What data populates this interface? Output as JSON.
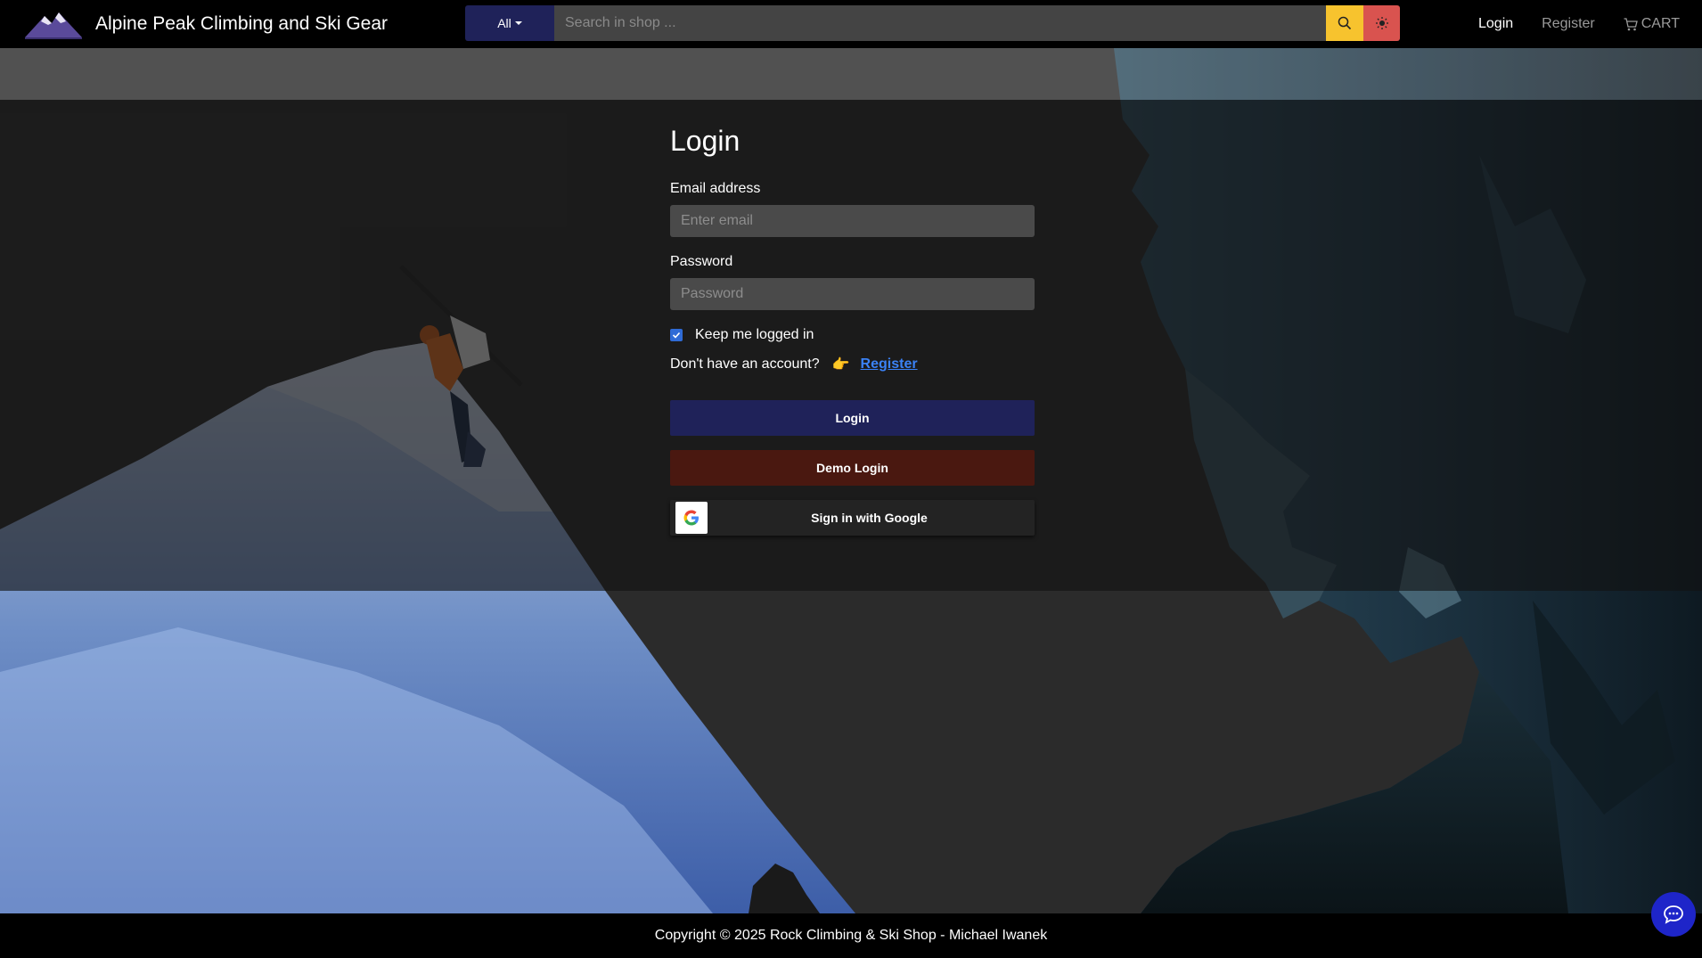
{
  "navbar": {
    "brand_title": "Alpine Peak Climbing and Ski Gear",
    "search": {
      "category": "All",
      "placeholder": "Search in shop ...",
      "value": ""
    },
    "links": {
      "login": "Login",
      "register": "Register",
      "cart": "CART"
    }
  },
  "login": {
    "title": "Login",
    "email_label": "Email address",
    "email_placeholder": "Enter email",
    "password_label": "Password",
    "password_placeholder": "Password",
    "remember_label": "Keep me logged in",
    "remember_checked": true,
    "no_account_text": "Don't have an account?",
    "hand_emoji": "👉",
    "register_link": "Register",
    "login_button": "Login",
    "demo_button": "Demo Login",
    "google_button": "Sign in with Google"
  },
  "footer": {
    "copyright": "Copyright © 2025 Rock Climbing & Ski Shop - Michael Iwanek"
  },
  "colors": {
    "navy": "#1f2259",
    "demo": "#4a1810",
    "search_yellow": "#f7c32e",
    "theme_red": "#d9534f",
    "link_blue": "#3b82f6",
    "chat_blue": "#1e25c9"
  },
  "icons": [
    "mountain-logo-icon",
    "search-icon",
    "sun-icon",
    "cart-icon",
    "google-icon",
    "chat-icon",
    "check-icon"
  ]
}
